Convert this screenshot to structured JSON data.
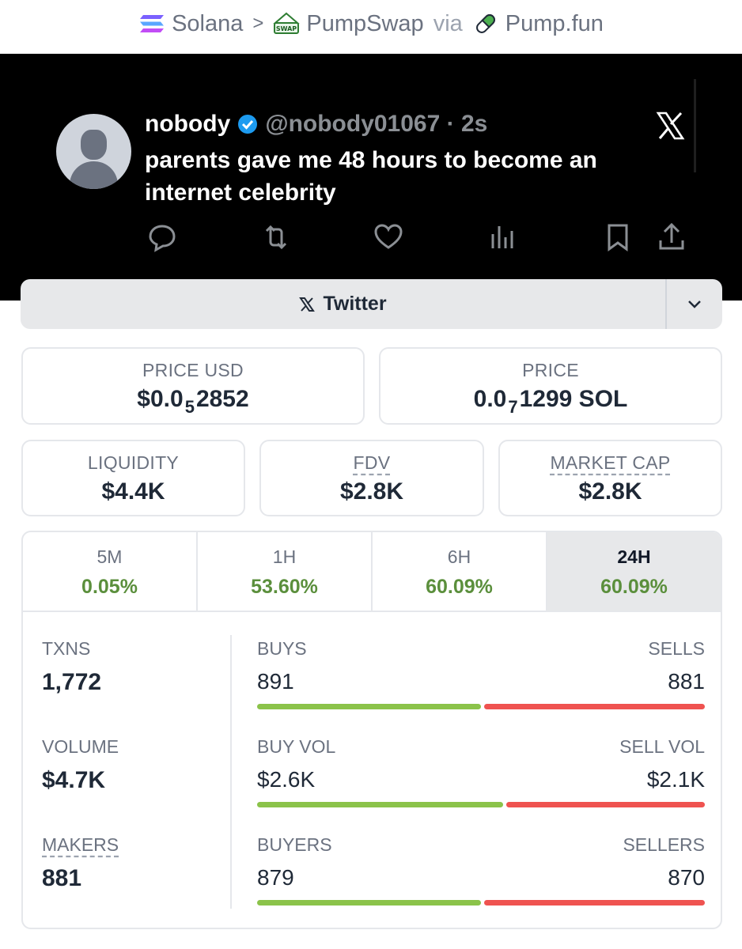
{
  "breadcrumb": {
    "chain": "Solana",
    "dex": "PumpSwap",
    "via": "via",
    "launchpad": "Pump.fun",
    "dex_badge": "SWAP"
  },
  "tweet": {
    "name": "nobody",
    "handle": "@nobody01067 · 2s",
    "text": "parents gave me 48 hours to become an internet celebrity"
  },
  "social": {
    "label": "Twitter"
  },
  "stats": {
    "price_usd": {
      "label": "PRICE USD",
      "prefix": "$0.0",
      "sub": "5",
      "rest": "2852"
    },
    "price_sol": {
      "label": "PRICE",
      "prefix": "0.0",
      "sub": "7",
      "rest": "1299 SOL"
    },
    "liquidity": {
      "label": "LIQUIDITY",
      "value": "$4.4K"
    },
    "fdv": {
      "label": "FDV",
      "value": "$2.8K"
    },
    "market_cap": {
      "label": "MARKET CAP",
      "value": "$2.8K"
    }
  },
  "tabs": [
    {
      "label": "5M",
      "value": "0.05%"
    },
    {
      "label": "1H",
      "value": "53.60%"
    },
    {
      "label": "6H",
      "value": "60.09%"
    },
    {
      "label": "24H",
      "value": "60.09%"
    }
  ],
  "txns": {
    "label": "TXNS",
    "value": "1,772"
  },
  "volume": {
    "label": "VOLUME",
    "value": "$4.7K"
  },
  "makers": {
    "label": "MAKERS",
    "value": "881"
  },
  "buys": {
    "left_label": "BUYS",
    "right_label": "SELLS",
    "left_value": "891",
    "right_value": "881",
    "ratio": 0.503
  },
  "vol": {
    "left_label": "BUY VOL",
    "right_label": "SELL VOL",
    "left_value": "$2.6K",
    "right_value": "$2.1K",
    "ratio": 0.553
  },
  "buyers": {
    "left_label": "BUYERS",
    "right_label": "SELLERS",
    "left_value": "879",
    "right_value": "870",
    "ratio": 0.503
  },
  "colors": {
    "positive": "#5b8f3c",
    "buy_bar": "#8bc34a",
    "sell_bar": "#ef5350"
  }
}
